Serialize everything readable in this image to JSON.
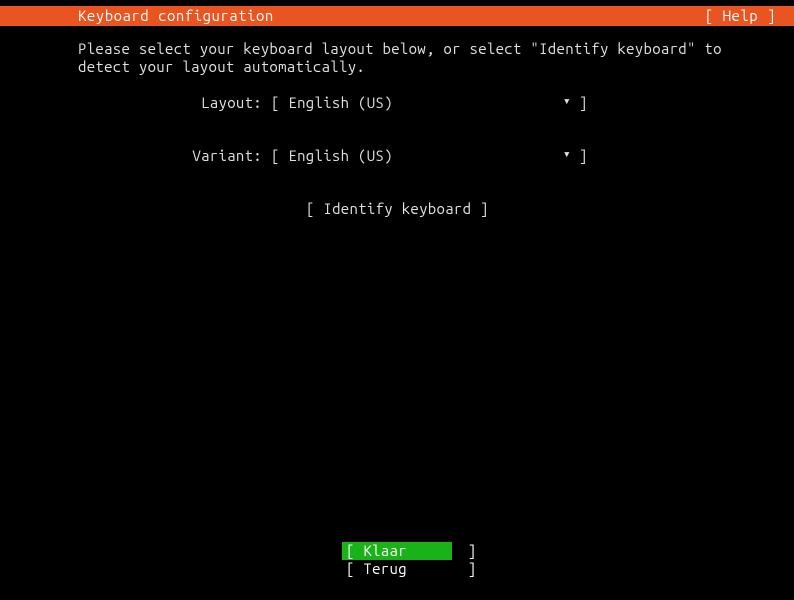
{
  "header": {
    "title": "Keyboard configuration",
    "help": "[ Help ]"
  },
  "instruction_line1": "Please select your keyboard layout below, or select \"Identify keyboard\" to",
  "instruction_line2": "detect your layout automatically.",
  "layout": {
    "label": "Layout:",
    "value": "[ English (US)",
    "arrow": "▾",
    "close": "]"
  },
  "variant": {
    "label": "Variant:",
    "value": "[ English (US)",
    "arrow": "▾",
    "close": "]"
  },
  "identify": {
    "label": "[ Identify keyboard ]"
  },
  "footer": {
    "done": "[ Klaar       ]",
    "back": "[ Terug       ]"
  }
}
